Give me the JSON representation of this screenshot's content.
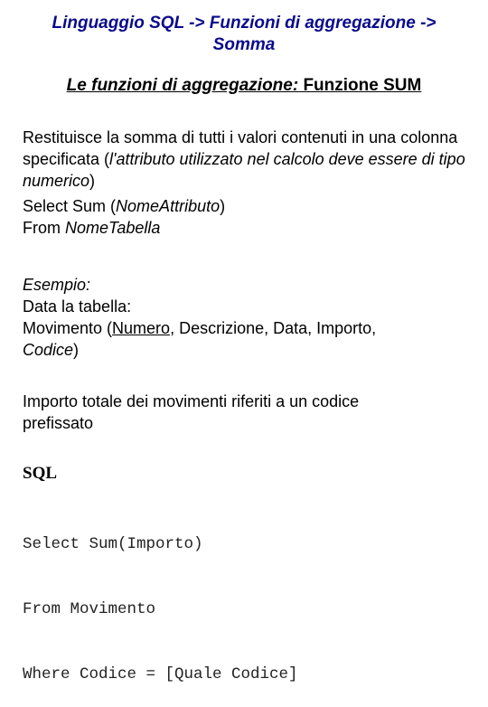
{
  "title": {
    "line1": "Linguaggio SQL -> Funzioni di aggregazione ->",
    "line2": "Somma"
  },
  "subtitle": {
    "italic_part": "Le funzioni di aggregazione:",
    "normal_part": " Funzione SUM"
  },
  "description": {
    "text1": "Restituisce la somma di tutti i valori contenuti in una colonna specificata (",
    "italic": "l'attributo utilizzato nel calcolo deve essere di tipo numerico",
    "text2": ")"
  },
  "syntax": {
    "select_prefix": "Select Sum (",
    "select_attr": "NomeAttributo",
    "select_suffix": ")",
    "from_prefix": "From ",
    "from_table": "NomeTabella"
  },
  "example": {
    "label": "Esempio:",
    "intro": "Data la tabella:",
    "table_name": "Movimento (",
    "key_field": "Numero",
    "other_fields": ", Descrizione, Data, Importo,",
    "foreign_field": "Codice",
    "close": ")"
  },
  "query_description": "Importo totale dei movimenti riferiti a un codice prefissato",
  "sql": {
    "heading": "SQL",
    "lines": [
      "Select Sum(Importo)",
      "From Movimento",
      "Where Codice = [Quale Codice]"
    ]
  }
}
